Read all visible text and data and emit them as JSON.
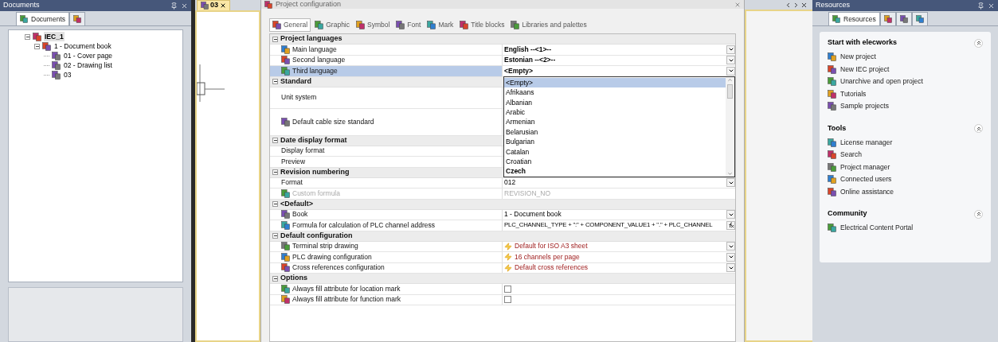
{
  "documents_panel": {
    "title": "Documents",
    "tabs": [
      {
        "label": "Documents",
        "selected": true
      },
      {
        "selected": false
      }
    ],
    "tree": [
      {
        "label": "IEC_1",
        "expanded": true,
        "selected": true,
        "children": [
          {
            "label": "1 - Document book",
            "expanded": true,
            "selected": false,
            "children": [
              {
                "label": "01 - Cover page",
                "selected": false
              },
              {
                "label": "02 - Drawing list",
                "selected": false
              },
              {
                "label": "03",
                "selected": false
              }
            ]
          }
        ]
      }
    ]
  },
  "document_tab": {
    "label": "03"
  },
  "dialog": {
    "title": "Project configuration",
    "tabs": [
      {
        "label": "General",
        "selected": true
      },
      {
        "label": "Graphic",
        "selected": false
      },
      {
        "label": "Symbol",
        "selected": false
      },
      {
        "label": "Font",
        "selected": false
      },
      {
        "label": "Mark",
        "selected": false
      },
      {
        "label": "Title blocks",
        "selected": false
      },
      {
        "label": "Libraries and palettes",
        "selected": false
      }
    ],
    "sections": [
      {
        "title": "Project languages",
        "expanded": true,
        "rows": [
          {
            "kind": "dropdown",
            "label": "Main language",
            "value": "English --<1>--",
            "bold": true,
            "selected": false,
            "disabled": false
          },
          {
            "kind": "dropdown",
            "label": "Second language",
            "value": "Estonian --<2>--",
            "bold": true,
            "selected": false,
            "disabled": false
          },
          {
            "kind": "dropdown",
            "label": "Third language",
            "value": "<Empty>",
            "bold": true,
            "selected": true,
            "disabled": false
          }
        ]
      },
      {
        "title": "Standard",
        "expanded": true,
        "rows": [
          {
            "kind": "covered_tall",
            "label": "Unit system",
            "selected": false,
            "disabled": false
          },
          {
            "kind": "covered_tall",
            "label": "Default cable size standard",
            "selected": false,
            "disabled": false
          }
        ]
      },
      {
        "title": "Date display format",
        "expanded": true,
        "rows": [
          {
            "kind": "covered",
            "label": "Display format",
            "selected": false,
            "disabled": false
          },
          {
            "kind": "covered",
            "label": "Preview",
            "selected": false,
            "disabled": false
          }
        ]
      },
      {
        "title": "Revision numbering",
        "expanded": true,
        "rows": [
          {
            "kind": "dropdown",
            "label": "Format",
            "value": "012",
            "bold": false,
            "selected": false,
            "disabled": false
          },
          {
            "kind": "text",
            "label": "Custom formula",
            "value": "REVISION_NO",
            "bold": false,
            "selected": false,
            "disabled": true
          }
        ]
      },
      {
        "title": "<Default>",
        "expanded": true,
        "rows": [
          {
            "kind": "dropdown",
            "label": "Book",
            "value": "1 - Document book",
            "bold": false,
            "selected": false,
            "disabled": false
          },
          {
            "kind": "formula",
            "label": "Formula for calculation of PLC channel address",
            "value": "PLC_CHANNEL_TYPE + \":\" + COMPONENT_VALUE1 + \".\" + PLC_CHANNEL",
            "bold": false,
            "selected": false,
            "disabled": false
          }
        ]
      },
      {
        "title": "Default configuration",
        "expanded": true,
        "rows": [
          {
            "kind": "config",
            "label": "Terminal strip drawing",
            "value": "Default for ISO A3 sheet",
            "bold": false,
            "selected": false,
            "disabled": false
          },
          {
            "kind": "config",
            "label": "PLC drawing configuration",
            "value": "16 channels per page",
            "bold": false,
            "selected": false,
            "disabled": false
          },
          {
            "kind": "config",
            "label": "Cross references configuration",
            "value": "Default cross references",
            "bold": false,
            "selected": false,
            "disabled": false
          }
        ]
      },
      {
        "title": "Options",
        "expanded": true,
        "rows": [
          {
            "kind": "checkbox",
            "label": "Always fill attribute for location mark",
            "checked": false,
            "selected": false,
            "disabled": false
          },
          {
            "kind": "checkbox",
            "label": "Always fill attribute for function mark",
            "checked": false,
            "selected": false,
            "disabled": false
          }
        ]
      }
    ],
    "dropdown_list": {
      "options": [
        {
          "label": "<Empty>",
          "selected": true,
          "bold": false
        },
        {
          "label": "Afrikaans",
          "selected": false,
          "bold": false
        },
        {
          "label": "Albanian",
          "selected": false,
          "bold": false
        },
        {
          "label": "Arabic",
          "selected": false,
          "bold": false
        },
        {
          "label": "Armenian",
          "selected": false,
          "bold": false
        },
        {
          "label": "Belarusian",
          "selected": false,
          "bold": false
        },
        {
          "label": "Bulgarian",
          "selected": false,
          "bold": false
        },
        {
          "label": "Catalan",
          "selected": false,
          "bold": false
        },
        {
          "label": "Croatian",
          "selected": false,
          "bold": false
        },
        {
          "label": "Czech",
          "selected": false,
          "bold": true
        }
      ]
    }
  },
  "resources_panel": {
    "title": "Resources",
    "tabs": [
      {
        "label": "Resources",
        "selected": true
      },
      {
        "selected": false
      },
      {
        "selected": false
      },
      {
        "selected": false
      }
    ],
    "sections": [
      {
        "title": "Start with elecworks",
        "expanded": true,
        "items": [
          "New project",
          "New IEC project",
          "Unarchive and open project",
          "Tutorials",
          "Sample projects"
        ]
      },
      {
        "title": "Tools",
        "expanded": true,
        "items": [
          "License manager",
          "Search",
          "Project manager",
          "Connected users",
          "Online assistance"
        ]
      },
      {
        "title": "Community",
        "expanded": true,
        "items": [
          "Electrical Content Portal"
        ]
      }
    ]
  }
}
